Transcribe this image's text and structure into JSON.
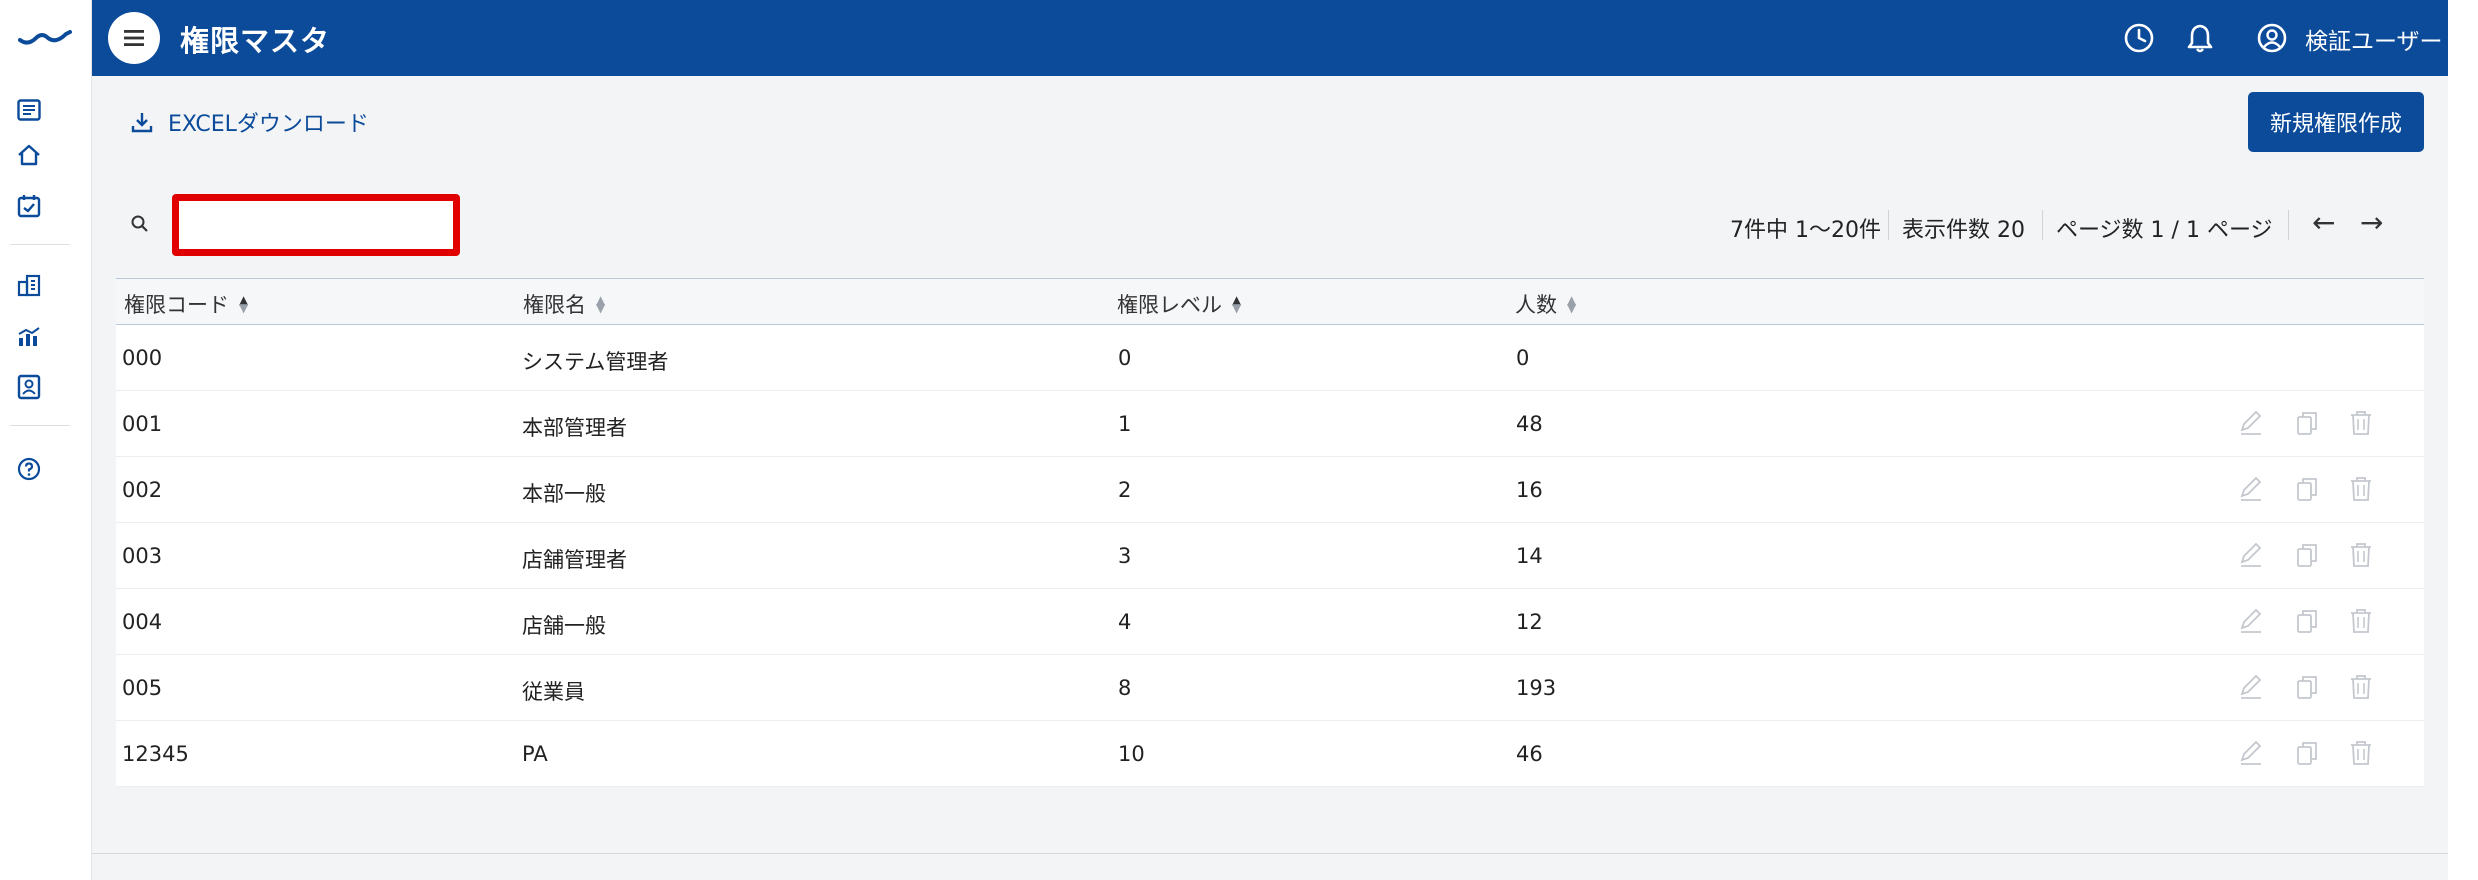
{
  "header": {
    "title": "権限マスタ",
    "user_name": "検証ユーザー"
  },
  "toolbar": {
    "excel_label": "EXCELダウンロード",
    "new_button_label": "新規権限作成"
  },
  "search": {
    "value": "",
    "placeholder": ""
  },
  "pager": {
    "range_text": "7件中 1〜20件",
    "per_page_text": "表示件数 20",
    "page_text": "ページ数 1 / 1 ページ",
    "prev_label": "←",
    "next_label": "→"
  },
  "table": {
    "columns": [
      "権限コード",
      "権限名",
      "権限レベル",
      "人数"
    ],
    "rows": [
      {
        "code": "000",
        "name": "システム管理者",
        "level": "0",
        "count": "0"
      },
      {
        "code": "001",
        "name": "本部管理者",
        "level": "1",
        "count": "48"
      },
      {
        "code": "002",
        "name": "本部一般",
        "level": "2",
        "count": "16"
      },
      {
        "code": "003",
        "name": "店舗管理者",
        "level": "3",
        "count": "14"
      },
      {
        "code": "004",
        "name": "店舗一般",
        "level": "4",
        "count": "12"
      },
      {
        "code": "005",
        "name": "従業員",
        "level": "8",
        "count": "193"
      },
      {
        "code": "12345",
        "name": "PA",
        "level": "10",
        "count": "46"
      }
    ]
  },
  "colors": {
    "primary": "#0b4b9a",
    "highlight": "#e00000",
    "background": "#f3f4f6"
  },
  "icons": {
    "sidebar": [
      "list-icon",
      "home-icon",
      "calendar-check-icon",
      "building-icon",
      "chart-icon",
      "id-card-icon",
      "help-icon"
    ],
    "header": [
      "history-icon",
      "bell-icon",
      "user-icon"
    ],
    "row_actions": [
      "edit-icon",
      "copy-icon",
      "delete-icon"
    ]
  }
}
